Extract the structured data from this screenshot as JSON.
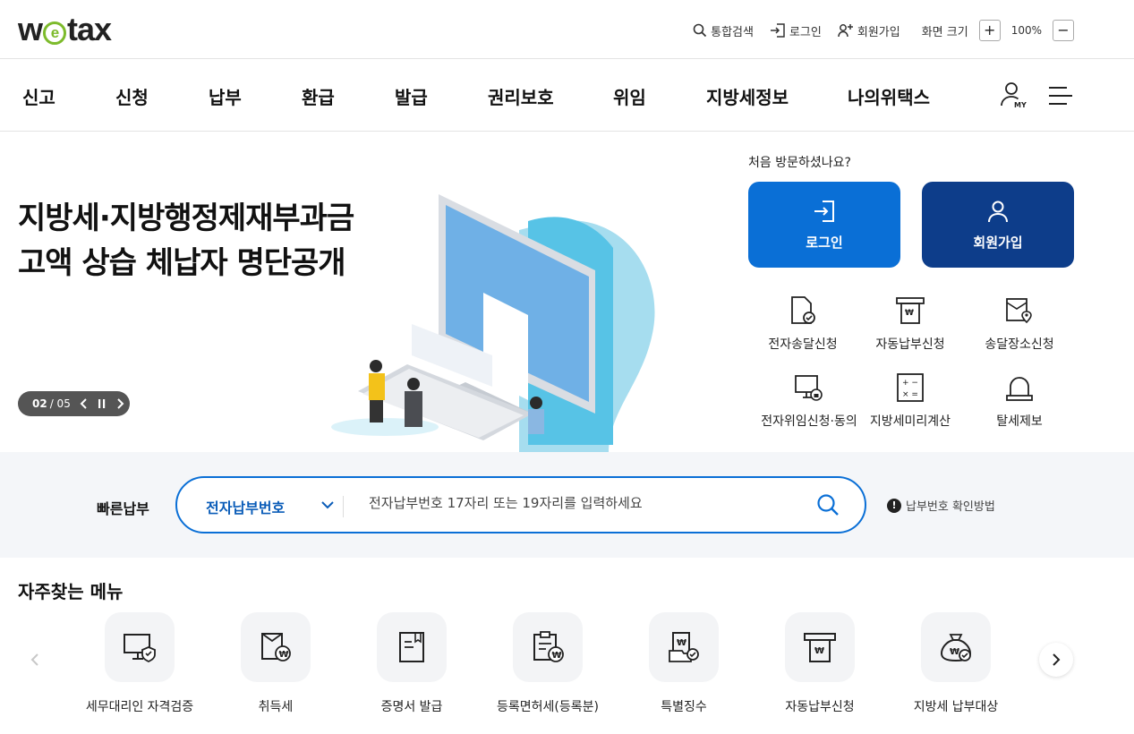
{
  "header": {
    "logo": {
      "pre": "w",
      "mid": "e",
      "post": "tax"
    },
    "util": {
      "search": "통합검색",
      "login": "로그인",
      "join": "회원가입",
      "font_size": "화면 크기",
      "plus": "+",
      "zoom": "100%",
      "minus": "−"
    }
  },
  "nav": {
    "items": [
      "신고",
      "신청",
      "납부",
      "환급",
      "발급",
      "권리보호",
      "위임",
      "지방세정보",
      "나의위택스"
    ],
    "my_label": "MY"
  },
  "hero": {
    "title_line1": "지방세·지방행정제재부과금",
    "title_line2": "고액 상습 체납자 명단공개",
    "slide_current": "02",
    "slide_total": "/ 05",
    "first_visit": "처음 방문하셨나요?",
    "login_button": "로그인",
    "join_button": "회원가입",
    "quick_links": [
      "전자송달신청",
      "자동납부신청",
      "송달장소신청",
      "전자위임신청·동의",
      "지방세미리계산",
      "탈세제보"
    ]
  },
  "fast_pay": {
    "label": "빠른납부",
    "select_value": "전자납부번호",
    "placeholder": "전자납부번호 17자리 또는 19자리를 입력하세요",
    "help": "납부번호 확인방법",
    "help_icon": "!"
  },
  "frequent": {
    "title": "자주찾는 메뉴",
    "items": [
      "세무대리인 자격검증",
      "취득세",
      "증명서 발급",
      "등록면허세(등록분)",
      "특별징수",
      "자동납부신청",
      "지방세 납부대상"
    ]
  },
  "colors": {
    "primary": "#0a6fd6",
    "navy": "#0d3d8a",
    "logo_green": "#7dbb2b",
    "fastpay_bg": "#f4f6f9"
  }
}
